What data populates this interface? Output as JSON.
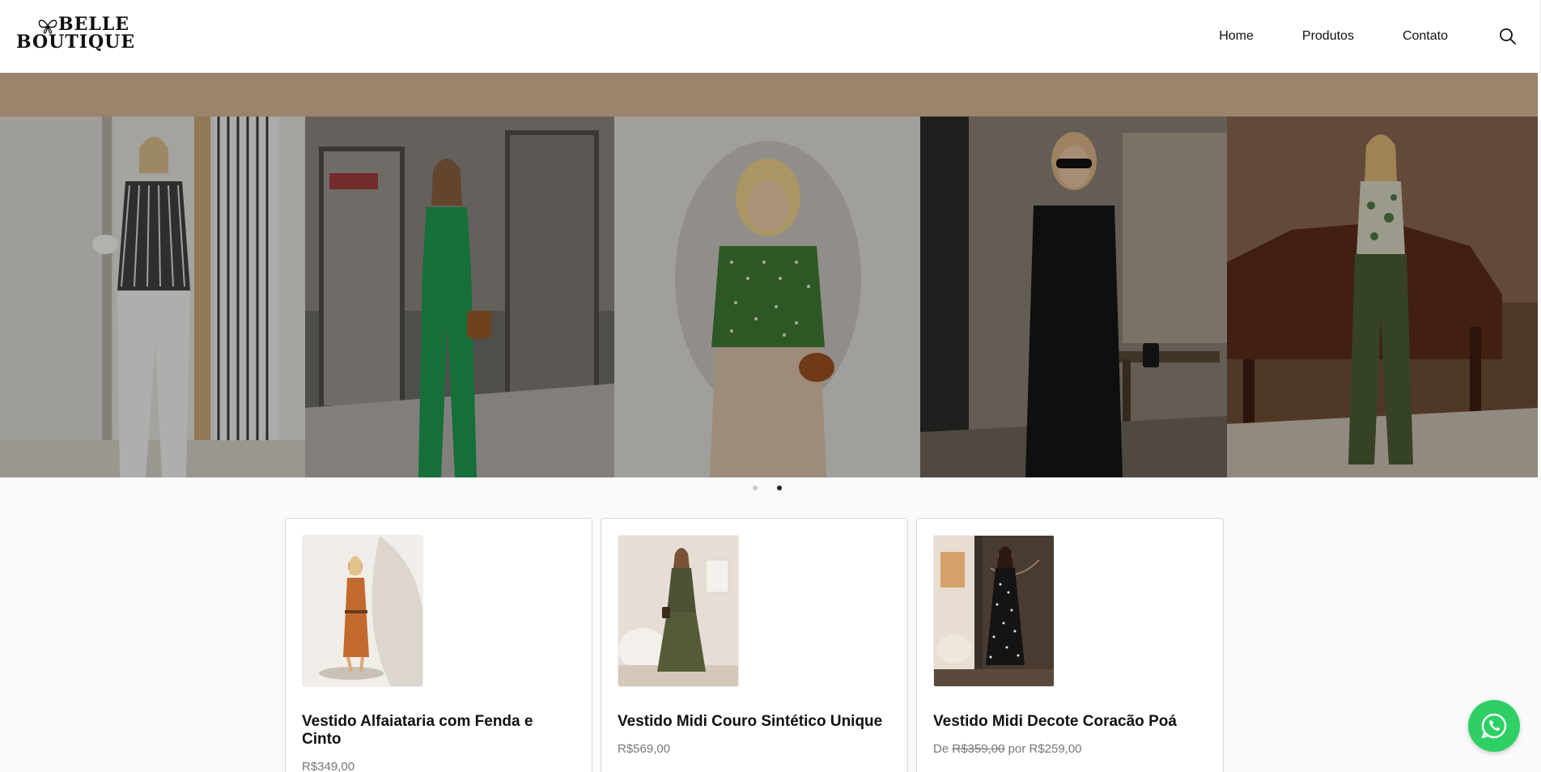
{
  "brand": {
    "logo_line1": "BELLE",
    "logo_line2": "BOUTIQUE"
  },
  "nav": {
    "items": [
      {
        "label": "Home"
      },
      {
        "label": "Produtos"
      },
      {
        "label": "Contato"
      }
    ],
    "search_icon": "search-icon"
  },
  "hero": {
    "band_color": "#9b836c",
    "slides": [
      {
        "description_icon": "model-white-pants"
      },
      {
        "description_icon": "model-green-jumpsuit"
      },
      {
        "description_icon": "model-green-dotted-top"
      },
      {
        "description_icon": "model-black-dress"
      },
      {
        "description_icon": "model-green-pants"
      }
    ],
    "dots": [
      {
        "active": false
      },
      {
        "active": true
      }
    ]
  },
  "products": [
    {
      "title": "Vestido Alfaiataria com Fenda e Cinto",
      "price": "R$349,00"
    },
    {
      "title": "Vestido Midi Couro Sintético Unique",
      "price": "R$569,00"
    },
    {
      "title": "Vestido Midi Decote Coracão Poá",
      "price_prefix": "De",
      "price_old": "R$359,00",
      "price_mid": "por",
      "price_new": "R$259,00"
    }
  ],
  "whatsapp": {
    "icon": "whatsapp-icon",
    "color": "#2ed065"
  }
}
